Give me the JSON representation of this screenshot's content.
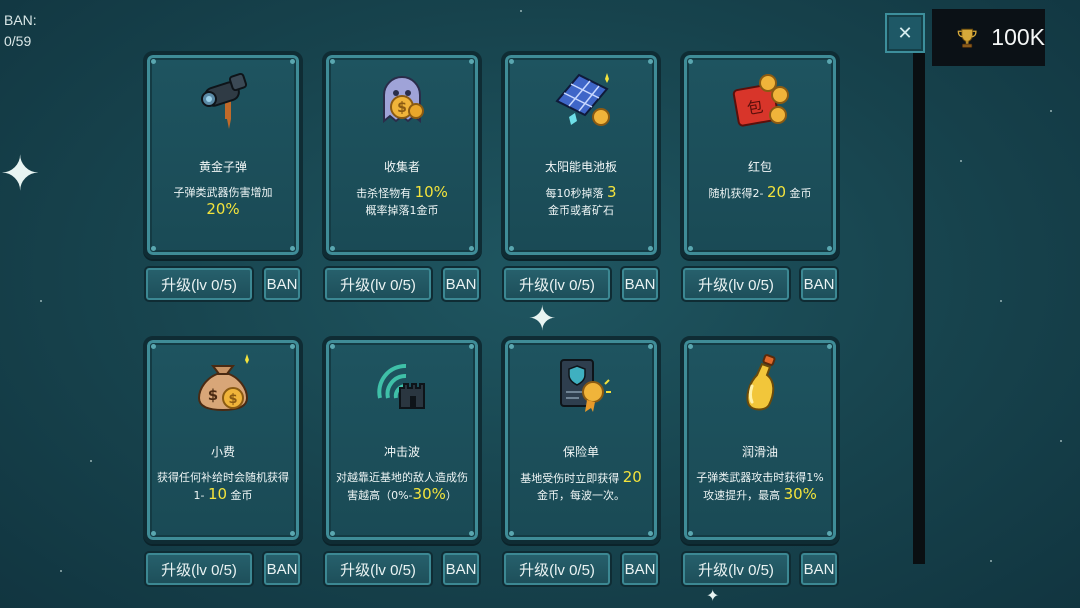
{
  "ban_counter": {
    "label": "BAN:",
    "value": "0/59"
  },
  "currency": {
    "amount": "100K",
    "icon": "trophy-icon"
  },
  "close_icon": "✕",
  "upgrade_label": "升级(lv 0/5)",
  "ban_label": "BAN",
  "highlight_color": "#f3e33c",
  "cards": [
    {
      "icon": "bullet-turret-icon",
      "name": "黄金子弹",
      "desc_pre": "子弹类武器伤害增加",
      "value": "20%",
      "desc_post": ""
    },
    {
      "icon": "ghost-coin-icon",
      "name": "收集者",
      "desc_pre": "击杀怪物有",
      "value": "10%",
      "desc_post": "概率掉落1金币"
    },
    {
      "icon": "solar-panel-icon",
      "name": "太阳能电池板",
      "desc_pre": "每10秒掉落",
      "value": "3",
      "desc_post": "金币或者矿石"
    },
    {
      "icon": "red-envelope-icon",
      "name": "红包",
      "desc_pre": "随机获得2-",
      "value": "20",
      "desc_post": "金币"
    },
    {
      "icon": "money-bag-icon",
      "name": "小费",
      "desc_pre": "获得任何补给时会随机获得1-",
      "value": "10",
      "desc_post": "金币"
    },
    {
      "icon": "shockwave-tower-icon",
      "name": "冲击波",
      "desc_pre": "对越靠近基地的敌人造成伤害越高（0%-",
      "value": "30%",
      "desc_post": "）"
    },
    {
      "icon": "insurance-policy-icon",
      "name": "保险单",
      "desc_pre": "基地受伤时立即获得",
      "value": "20",
      "desc_post": "金币，每波一次。"
    },
    {
      "icon": "oil-bottle-icon",
      "name": "润滑油",
      "desc_pre": "子弹类武器攻击时获得1%攻速提升，最高",
      "value": "30%",
      "desc_post": ""
    }
  ]
}
